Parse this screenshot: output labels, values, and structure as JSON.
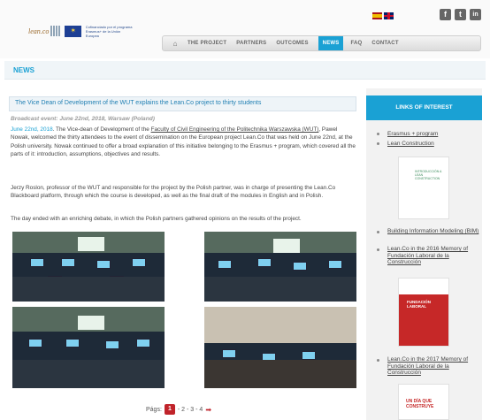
{
  "header": {
    "logo_text": "lean.co",
    "eu_text": "Cofinanciado por el programa Erasmus+ de la Unión Europea",
    "languages": [
      "es",
      "en"
    ],
    "social": [
      {
        "name": "facebook",
        "glyph": "f"
      },
      {
        "name": "twitter",
        "glyph": "t"
      },
      {
        "name": "linkedin",
        "glyph": "in"
      }
    ]
  },
  "nav": {
    "home_icon": "home-icon",
    "items": [
      "THE PROJECT",
      "PARTNERS",
      "OUTCOMES",
      "NEWS",
      "FAQ",
      "CONTACT"
    ],
    "active": "NEWS"
  },
  "section_title": "NEWS",
  "article": {
    "title": "The Vice Dean of Development of the WUT explains the Lean.Co project to thirty students",
    "meta": "Broadcast event: June 22nd, 2018, Warsaw (Poland)",
    "p1_date": "June 22nd, 2018",
    "p1_a": ". The Vice-dean of Development of the ",
    "p1_link": "Faculty of Civil Engineering of the Politechnika Warszawska (WUT)",
    "p1_b": ", Pawel Nowak, welcomed the thirty attendees to the event of dissemination on the European project Lean.Co that was held on June 22nd, at the Polish university. Nowak continued to offer a broad explanation of this initiative belonging to the Erasmus + program, which covered all the parts of it: introduction, assumptions, objectives and results.",
    "p2": "Jerzy Roslon, professor of the WUT and responsible for the project by the Polish partner, was in charge of presenting the Lean.Co Blackboard platform, through which the course is developed, as well as the final draft of the modules in English and in Polish.",
    "p3": "The day ended with an enriching debate, in which the Polish partners gathered opinions on the results of the project."
  },
  "pager": {
    "label": "Págs:",
    "current": "1",
    "others": "- 2 - 3 - 4",
    "next_icon": "arrow-right-icon"
  },
  "sidebar": {
    "title": "LINKS OF INTEREST",
    "links": [
      "Erasmus + program",
      "Lean Construction",
      "Building Information Modeling (BIM)",
      "Lean.Co in the 2016 Memory of Fundación Laboral de la Construcción",
      "Lean.Co in the 2017 Memory of Fundación Laboral de la Construcción"
    ],
    "thumb1_text": "INTRODUCCIÓN A LEAN CONSTRUCTION",
    "thumb2_text": "FUNDACIÓN LABORAL",
    "thumb3_text": "UN DÍA QUE CONSTRUYE"
  }
}
